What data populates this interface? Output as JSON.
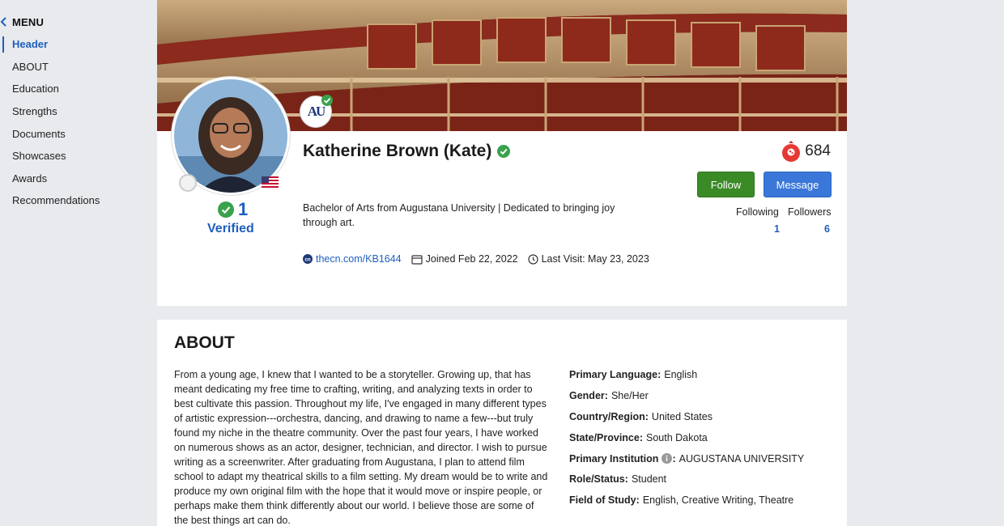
{
  "sidebar": {
    "menu_title": "MENU",
    "items": [
      {
        "label": "Header"
      },
      {
        "label": "ABOUT"
      },
      {
        "label": "Education"
      },
      {
        "label": "Strengths"
      },
      {
        "label": "Documents"
      },
      {
        "label": "Showcases"
      },
      {
        "label": "Awards"
      },
      {
        "label": "Recommendations"
      }
    ]
  },
  "profile": {
    "name": "Katherine Brown (Kate)",
    "verified_count": "1",
    "verified_label": "Verified",
    "school_logo_text": "AU",
    "bio": "Bachelor of Arts from Augustana University | Dedicated to bringing joy through art.",
    "link": "thecn.com/KB1644",
    "joined": "Joined Feb 22, 2022",
    "last_visit": "Last Visit: May 23, 2023",
    "points": "684",
    "follow_label": "Follow",
    "message_label": "Message",
    "following_label": "Following",
    "followers_label": "Followers",
    "following_count": "1",
    "followers_count": "6"
  },
  "about": {
    "title": "ABOUT",
    "text": "From a young age, I knew that I wanted to be a storyteller. Growing up, that has meant dedicating my free time to crafting, writing, and analyzing texts in order to best cultivate this passion. Throughout my life, I've engaged in many different types of artistic expression---orchestra, dancing, and drawing to name a few---but truly found my niche in the theatre community. Over the past four years, I have worked on numerous shows as an actor, designer, technician, and director. I wish to pursue writing as a screenwriter. After graduating from Augustana, I plan to attend film school to adapt my theatrical skills to a film setting. My dream would be to write and produce my own original film with the hope that it would move or inspire people, or perhaps make them think differently about our world. I believe those are some of the best things art can do.",
    "details": [
      {
        "key": "Primary Language:",
        "value": "English"
      },
      {
        "key": "Gender:",
        "value": "She/Her"
      },
      {
        "key": "Country/Region:",
        "value": "United States"
      },
      {
        "key": "State/Province:",
        "value": "South Dakota"
      },
      {
        "key": "Primary Institution",
        "value": "AUGUSTANA UNIVERSITY"
      },
      {
        "key": "Role/Status:",
        "value": "Student"
      },
      {
        "key": "Field of Study:",
        "value": "English, Creative Writing, Theatre"
      }
    ]
  },
  "colors": {
    "accent_blue": "#1f5fbf",
    "follow_green": "#3a8a26",
    "message_blue": "#3a77d8",
    "verified_green": "#3aa14c"
  }
}
